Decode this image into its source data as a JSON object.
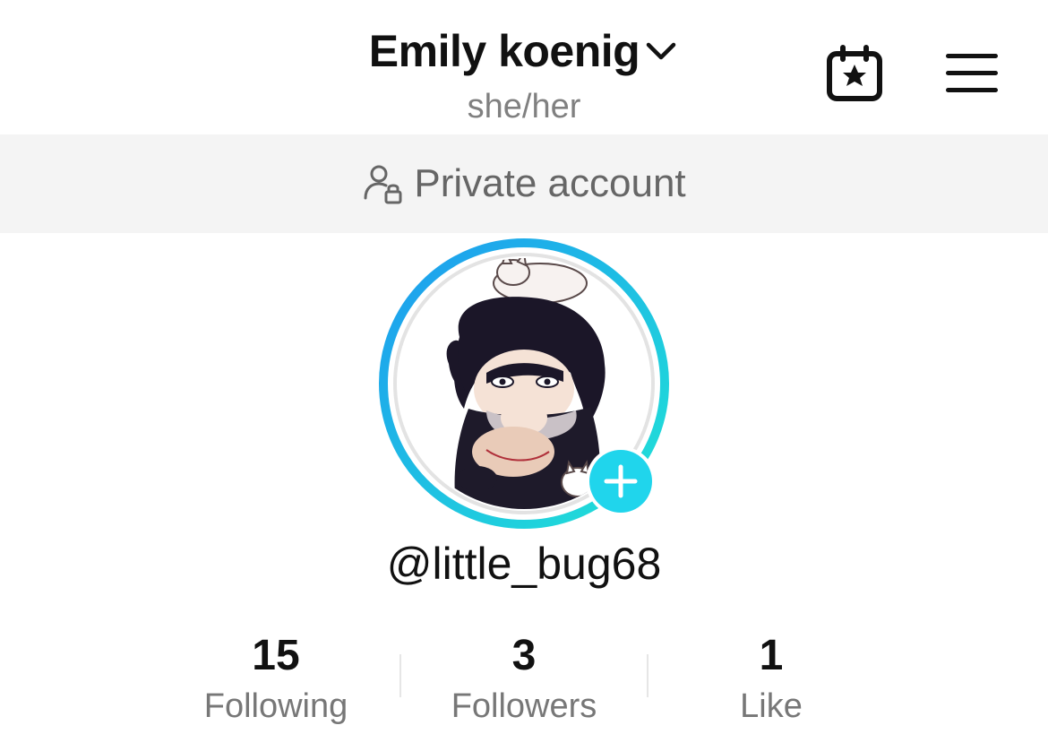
{
  "header": {
    "display_name": "Emily koenig",
    "pronouns": "she/her",
    "chevron_icon": "chevron-down-icon",
    "calendar_icon": "calendar-star-icon",
    "menu_icon": "hamburger-menu-icon"
  },
  "banner": {
    "text": "Private account",
    "icon": "user-lock-icon"
  },
  "profile": {
    "username": "@little_bug68",
    "avatar_icon": "avatar-image",
    "add_icon": "plus-icon"
  },
  "stats": [
    {
      "value": "15",
      "label": "Following"
    },
    {
      "value": "3",
      "label": "Followers"
    },
    {
      "value": "1",
      "label": "Like"
    }
  ],
  "colors": {
    "accent": "#20d5ec",
    "ring_start": "#1d9bf0",
    "ring_end": "#20e3d6",
    "banner_bg": "#f4f4f4"
  }
}
